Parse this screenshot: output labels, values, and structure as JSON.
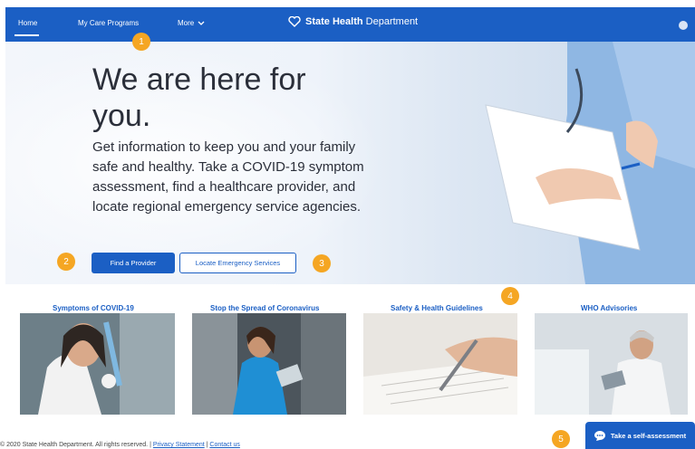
{
  "nav": {
    "home": "Home",
    "care_programs": "My Care Programs",
    "more": "More",
    "brand_bold": "State Health",
    "brand_light": "Department"
  },
  "hero": {
    "title": "We are here for you.",
    "text": "Get information to keep you and your family safe and healthy. Take a COVID-19 symptom assessment, find a healthcare provider, and locate regional emergency service agencies.",
    "primary_button": "Find a Provider",
    "secondary_button": "Locate Emergency Services"
  },
  "markers": [
    "1",
    "2",
    "3",
    "4",
    "5"
  ],
  "cards": [
    {
      "title": "Symptoms of COVID-19"
    },
    {
      "title": "Stop the Spread of Coronavirus"
    },
    {
      "title": "Safety & Health Guidelines"
    },
    {
      "title": "WHO Advisories"
    }
  ],
  "footer": {
    "text": "© 2020 State Health Department. All rights reserved. |",
    "privacy": "Privacy Statement",
    "separator": "|",
    "contact": "Contact us"
  },
  "chat": {
    "label": "Take a self-assessment"
  },
  "colors": {
    "brand": "#1b5fc4",
    "marker": "#f5a623",
    "text": "#2b2f3a"
  }
}
